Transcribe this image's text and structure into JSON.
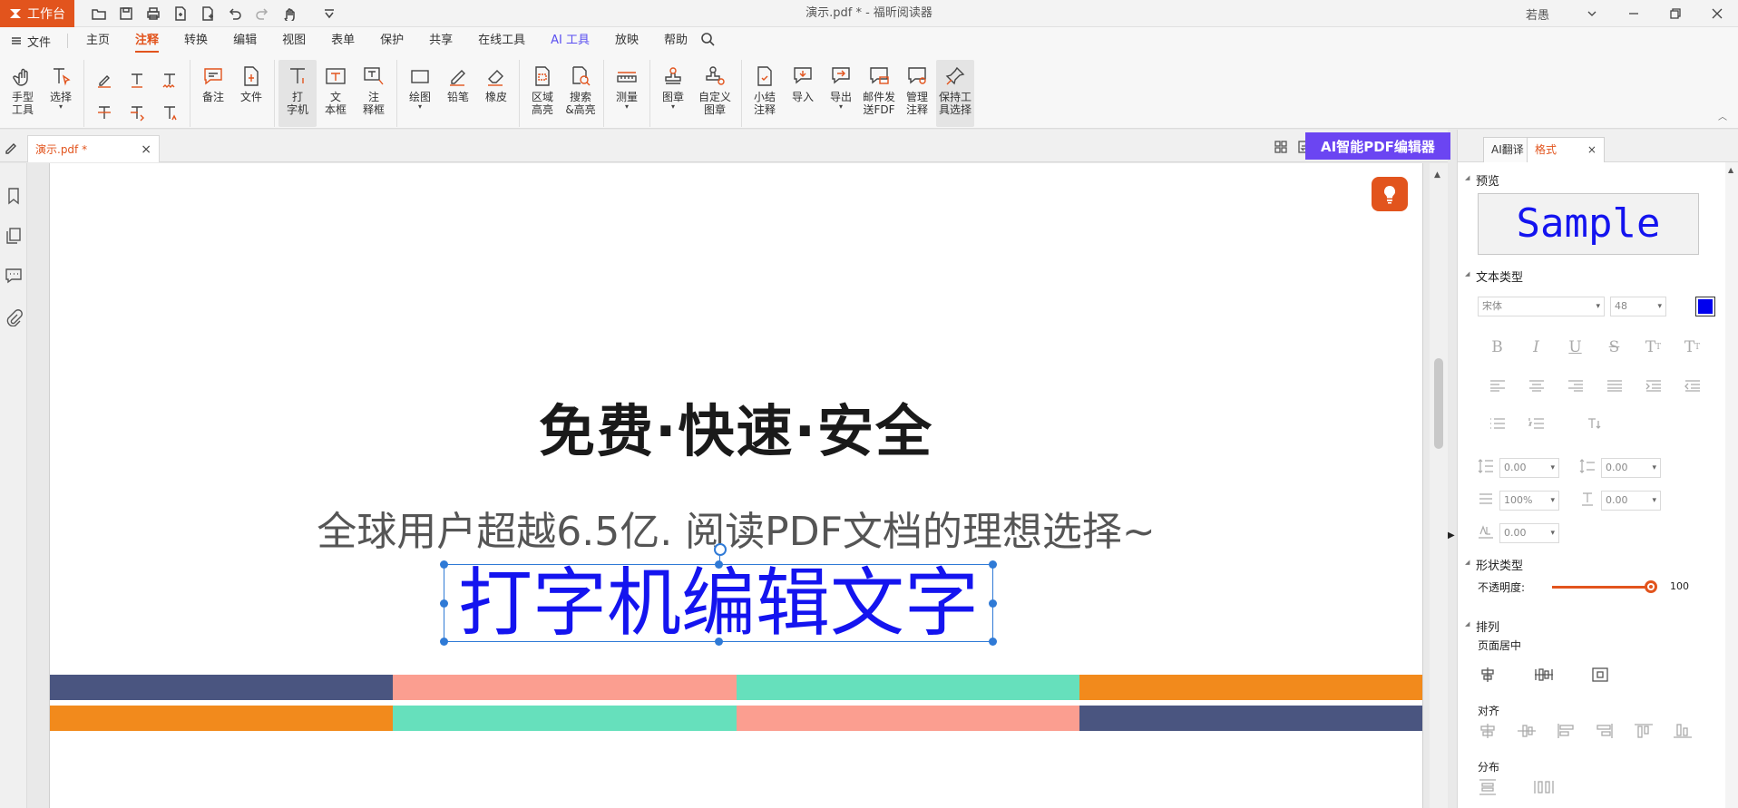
{
  "titlebar": {
    "workbench_label": "工作台",
    "title": "演示.pdf * - 福昕阅读器",
    "user": "若愚"
  },
  "menu": {
    "file_label": "文件",
    "tabs": [
      "主页",
      "注释",
      "转换",
      "编辑",
      "视图",
      "表单",
      "保护",
      "共享",
      "在线工具",
      "AI 工具",
      "放映",
      "帮助"
    ],
    "active_tab": "注释"
  },
  "ribbon": {
    "hand_tool": "手型\n工具",
    "select": "选择",
    "note": "备注",
    "file": "文件",
    "typewriter": "打\n字机",
    "textbox": "文\n本框",
    "callout": "注\n释框",
    "draw": "绘图",
    "pencil": "铅笔",
    "eraser": "橡皮",
    "area_highlight": "区域\n高亮",
    "search_highlight": "搜索\n&高亮",
    "measure": "测量",
    "stamp": "图章",
    "custom_stamp": "自定义\n图章",
    "summary": "小结\n注释",
    "import": "导入",
    "export": "导出",
    "email_fdf": "邮件发\n送FDF",
    "manage": "管理\n注释",
    "keep_tool": "保持工\n具选择"
  },
  "docbar": {
    "tab_label": "演示.pdf *",
    "ai_banner": "AI智能PDF编辑器"
  },
  "page": {
    "headline": "免费·快速·安全",
    "subline": "全球用户超越6.5亿. 阅读PDF文档的理想选择~",
    "typed_text": "打字机编辑文字",
    "stripe1_colors": [
      "#4a5580",
      "#fb9e90",
      "#66e0bc",
      "#f28a1c"
    ],
    "stripe2_colors": [
      "#f28a1c",
      "#66e0bc",
      "#fb9e90",
      "#4a5580"
    ]
  },
  "rpanel": {
    "tab_translate": "AI翻译",
    "tab_format": "格式",
    "preview_title": "预览",
    "preview_sample": "Sample",
    "text_type_title": "文本类型",
    "font_name": "宋体",
    "font_size": "48",
    "text_color": "#0000ee",
    "line_spacing": "0.00",
    "para_spacing": "0.00",
    "char_scale": "100%",
    "baseline": "0.00",
    "char_spacing": "0.00",
    "shape_type_title": "形状类型",
    "opacity_label": "不透明度:",
    "opacity_value": "100",
    "arrange_title": "排列",
    "page_center_label": "页面居中",
    "align_label": "对齐",
    "distribute_label": "分布"
  }
}
